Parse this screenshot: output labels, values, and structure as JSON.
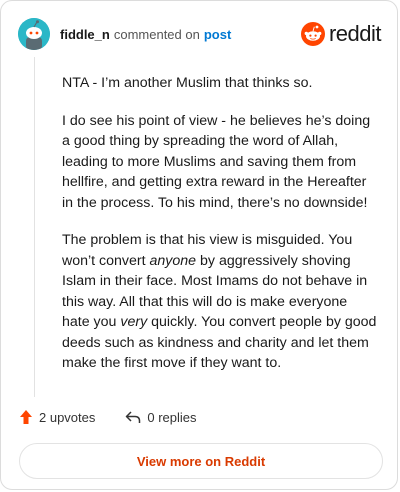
{
  "header": {
    "username": "fiddle_n",
    "action_text": "commented on",
    "post_link": "post",
    "brand": "reddit"
  },
  "comment": {
    "paragraphs": [
      {
        "segments": [
          {
            "text": "NTA - I’m another Muslim that thinks so.",
            "italic": false
          }
        ]
      },
      {
        "segments": [
          {
            "text": "I do see his point of view - he believes he’s doing a good thing by spreading the word of Allah, leading to more Muslims and saving them from hellfire, and getting extra reward in the Hereafter in the process. To his mind, there’s no downside!",
            "italic": false
          }
        ]
      },
      {
        "segments": [
          {
            "text": "The problem is that his view is misguided. You won’t convert ",
            "italic": false
          },
          {
            "text": "anyone",
            "italic": true
          },
          {
            "text": " by aggressively shoving Islam in their face. Most Imams do not behave in this way. All that this will do is make everyone hate you ",
            "italic": false
          },
          {
            "text": "very",
            "italic": true
          },
          {
            "text": " quickly. You convert people by good deeds such as kindness and charity and let them make the first move if they want to.",
            "italic": false
          }
        ]
      }
    ]
  },
  "actions": {
    "upvotes": "2 upvotes",
    "replies": "0 replies"
  },
  "footer": {
    "view_more": "View more on Reddit"
  },
  "colors": {
    "brand_orange": "#ff4500",
    "link_blue": "#0079d3",
    "avatar_teal": "#2bb7c7"
  }
}
